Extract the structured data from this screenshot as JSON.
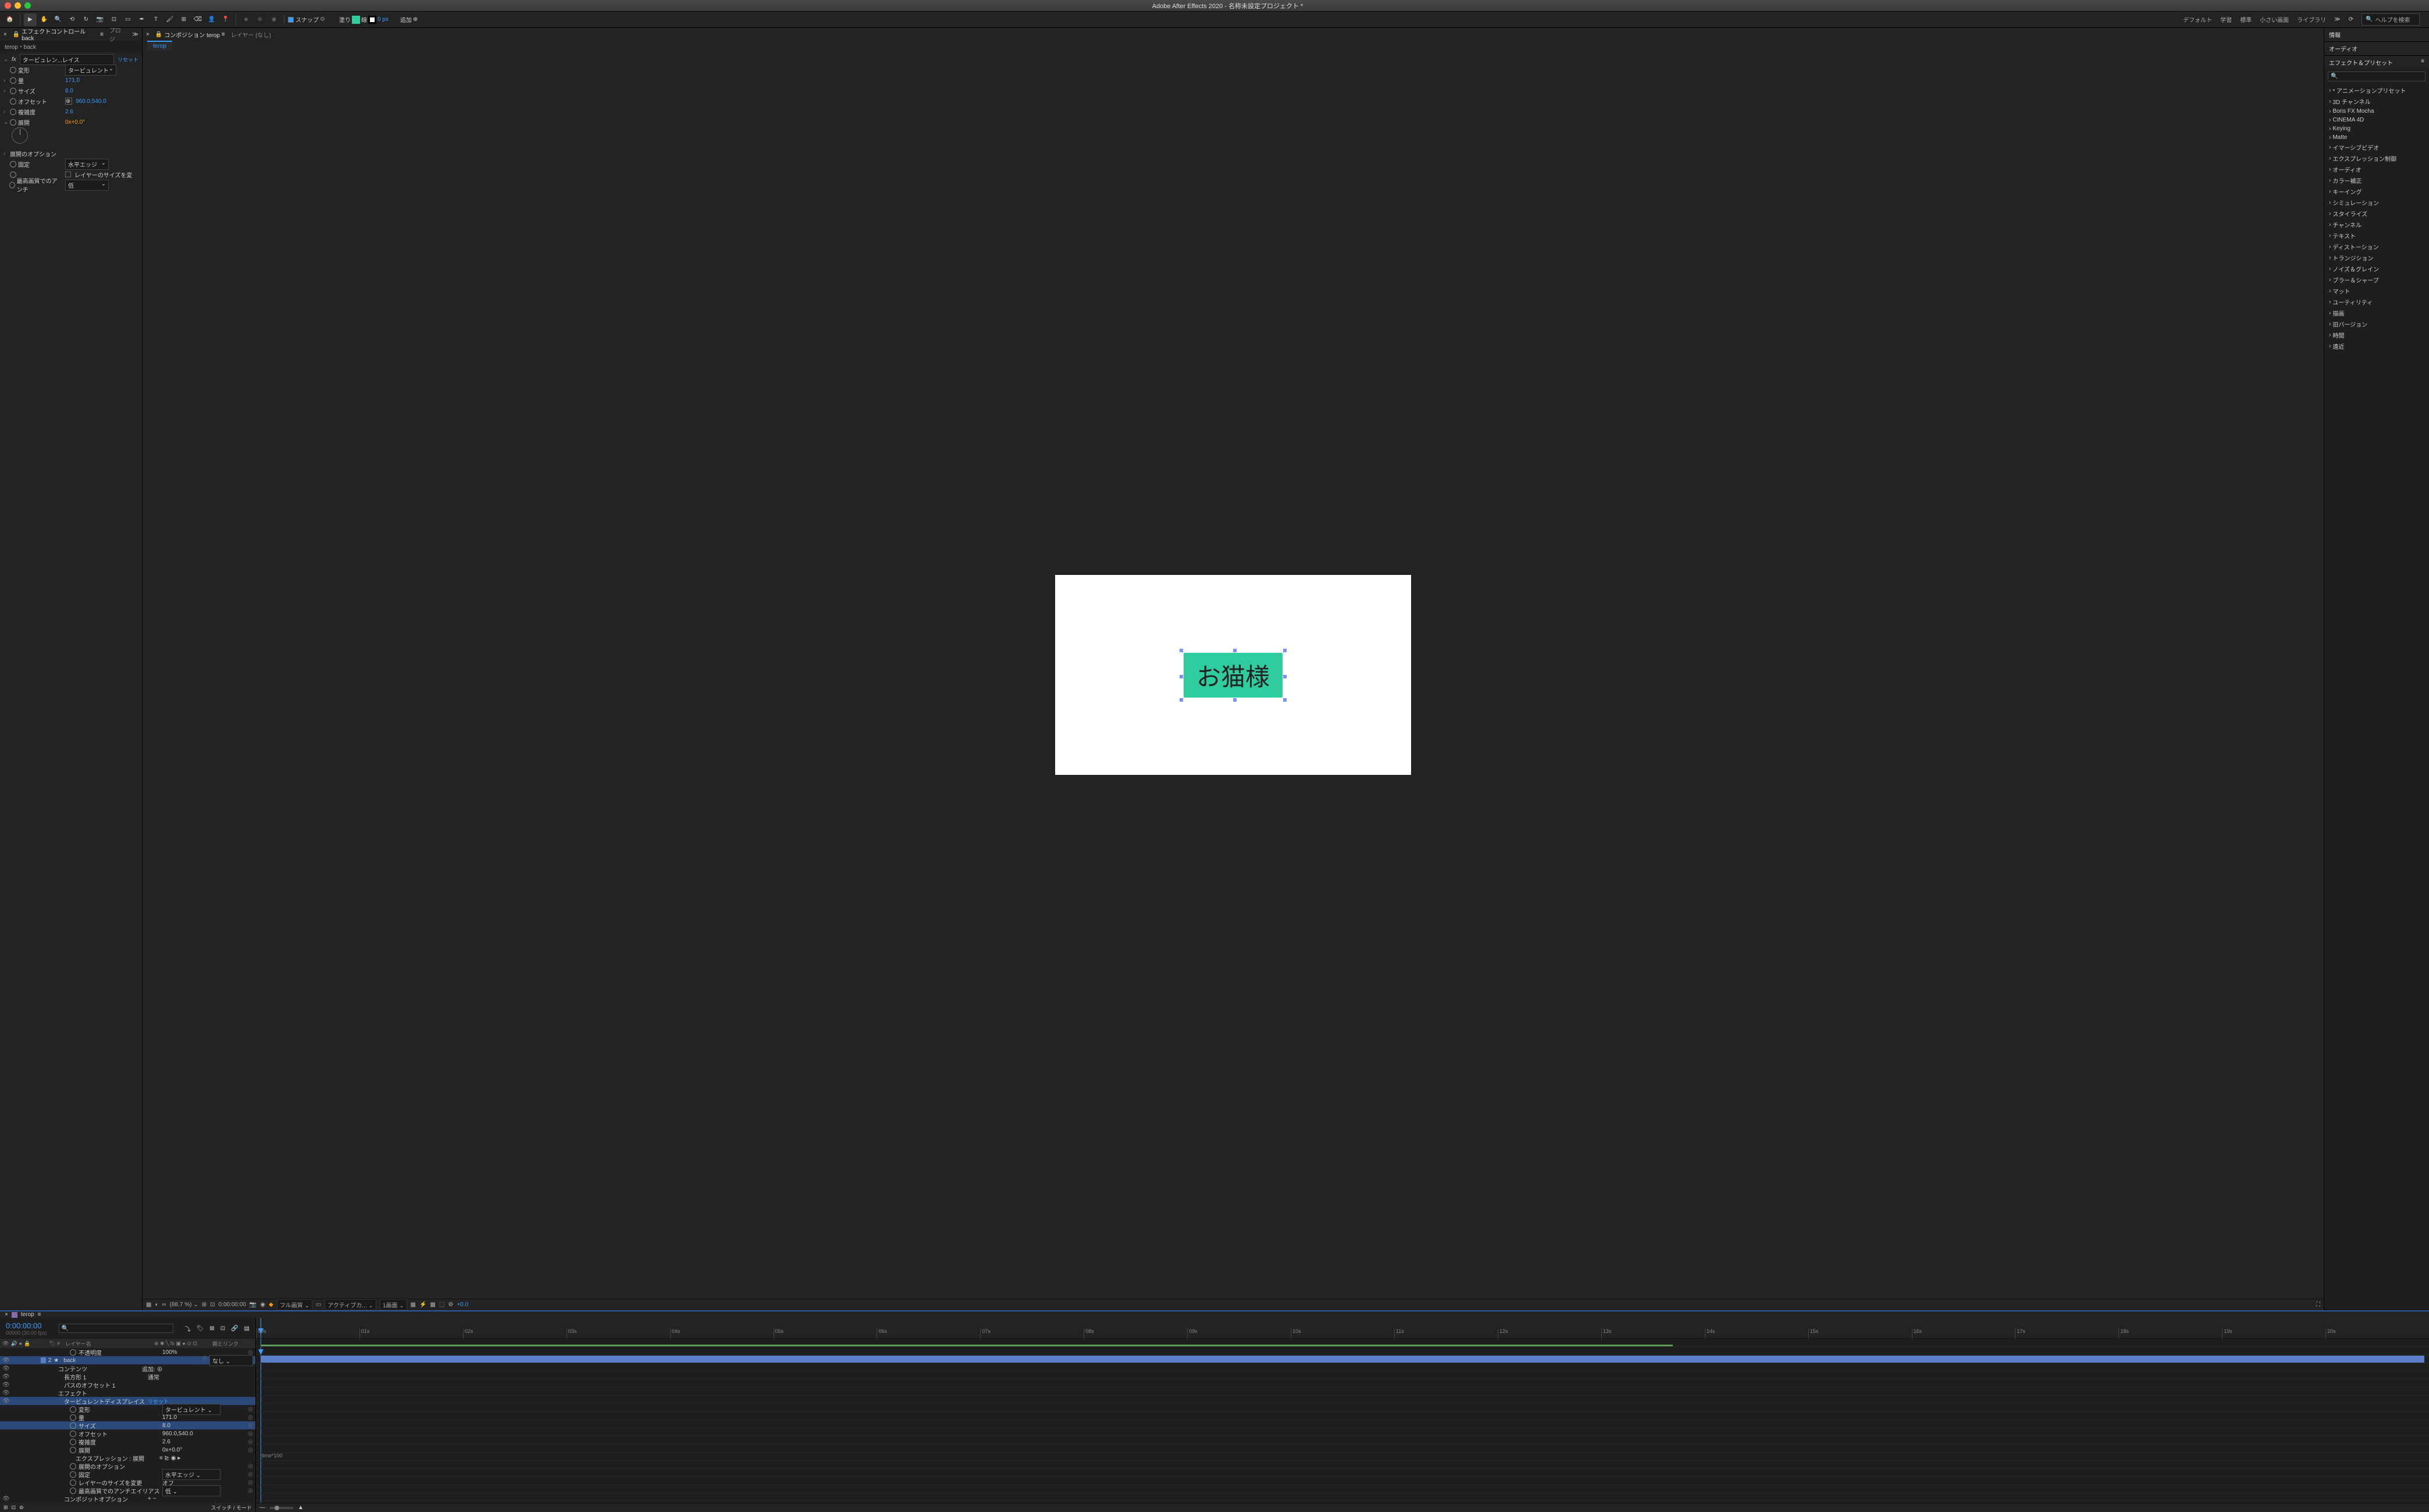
{
  "app": {
    "title": "Adobe After Effects 2020 - 名称未設定プロジェクト *"
  },
  "toolbar": {
    "snap": "スナップ",
    "fill_label": "塗り",
    "stroke_px": "0 px",
    "add": "追加"
  },
  "workspaces": [
    "デフォルト",
    "学習",
    "標準",
    "小さい画面",
    "ライブラリ"
  ],
  "search_placeholder": "ヘルプを検索",
  "effect_controls": {
    "tab_label": "エフェクトコントロール back",
    "project_tab": "プロジ",
    "crumb": "terop・back",
    "effect_name": "タービュレン...レイス",
    "reset": "リセット",
    "props": {
      "deform": {
        "label": "変形",
        "value": "タービュレント"
      },
      "amount": {
        "label": "量",
        "value": "171.0"
      },
      "size": {
        "label": "サイズ",
        "value": "8.0"
      },
      "offset": {
        "label": "オフセット",
        "value": "960.0,540.0"
      },
      "complexity": {
        "label": "複雑度",
        "value": "2.6"
      },
      "evolution": {
        "label": "展開",
        "value": "0x+0.0°"
      },
      "evo_options": "展開のオプション",
      "pinning": {
        "label": "固定",
        "value": "水平エッジ"
      },
      "resize_layer": "レイヤーのサイズを変",
      "antialias": {
        "label": "最高画質でのアンチ",
        "value": "低"
      }
    }
  },
  "composition": {
    "tab_label": "コンポジション terop",
    "layer_tab": "レイヤー (なし)",
    "comp_name": "terop",
    "telop_text": "お猫様"
  },
  "viewer_footer": {
    "zoom": "(88.7 %)",
    "time": "0:00:00:00",
    "quality": "フル画質",
    "view": "アクティブカ...",
    "views": "1画面",
    "exposure": "+0.0"
  },
  "right_panels": {
    "info": "情報",
    "audio": "オーディオ",
    "effects_presets": "エフェクト＆プリセット",
    "categories": [
      "* アニメーションプリセット",
      "3D チャンネル",
      "Boris FX Mocha",
      "CINEMA 4D",
      "Keying",
      "Matte",
      "イマーシブビデオ",
      "エクスプレッション制御",
      "オーディオ",
      "カラー補正",
      "キーイング",
      "シミュレーション",
      "スタイライズ",
      "チャンネル",
      "テキスト",
      "ディストーション",
      "トランジション",
      "ノイズ＆グレイン",
      "ブラー＆シャープ",
      "マット",
      "ユーティリティ",
      "描画",
      "旧バージョン",
      "時間",
      "遠近"
    ]
  },
  "timeline": {
    "comp_name": "terop",
    "timecode": "0:00:00:00",
    "framecount": "00000 (30.00 fps)",
    "col_layer_name": "レイヤー名",
    "col_parent": "親とリンク",
    "col_switches": "スイッチ / モード",
    "add_label": "追加:",
    "ticks": [
      "00s",
      "01s",
      "02s",
      "03s",
      "04s",
      "05s",
      "06s",
      "07s",
      "08s",
      "09s",
      "10s",
      "11s",
      "12s",
      "13s",
      "14s",
      "15s",
      "16s",
      "17s",
      "18s",
      "19s",
      "20s"
    ],
    "rows": [
      {
        "label": "不透明度",
        "value": "100%",
        "indent": 4
      },
      {
        "num": "2",
        "label": "back",
        "parent": "なし",
        "indent": 0,
        "sel": true,
        "color": "#5b7fc7"
      },
      {
        "label": "コンテンツ",
        "indent": 2,
        "add": true
      },
      {
        "label": "長方形 1",
        "value": "通常",
        "indent": 3
      },
      {
        "label": "パスのオフセット 1",
        "indent": 3
      },
      {
        "label": "エフェクト",
        "indent": 2
      },
      {
        "label": "タービュレントディスプレイス",
        "value_link": "リセット",
        "indent": 3,
        "sel": true
      },
      {
        "label": "変形",
        "value": "タービュレント",
        "dropdown": true,
        "indent": 4
      },
      {
        "label": "量",
        "value": "171.0",
        "indent": 4
      },
      {
        "label": "サイズ",
        "value": "8.0",
        "indent": 4,
        "sel": true
      },
      {
        "label": "オフセット",
        "value": "960.0,540.0",
        "indent": 4
      },
      {
        "label": "複雑度",
        "value": "2.6",
        "indent": 4
      },
      {
        "label": "展開",
        "value": "0x+0.0°",
        "orange": true,
        "indent": 4
      },
      {
        "label": "エクスプレッション : 展開",
        "expr": true,
        "indent": 5,
        "expression": "time*100"
      },
      {
        "label": "展開のオプション",
        "indent": 4
      },
      {
        "label": "固定",
        "value": "水平エッジ",
        "dropdown": true,
        "indent": 4
      },
      {
        "label": "レイヤーのサイズを変更",
        "value": "オフ",
        "indent": 4
      },
      {
        "label": "最高画質でのアンチエイリアス",
        "value": "低",
        "dropdown": true,
        "indent": 4
      },
      {
        "label": "コンポジットオプション",
        "value": "+ −",
        "indent": 3
      }
    ]
  }
}
